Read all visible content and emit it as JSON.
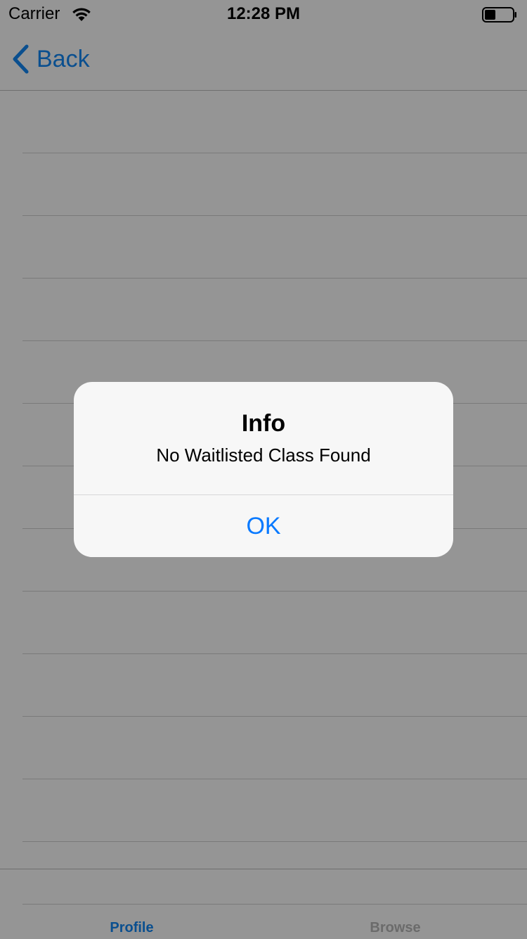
{
  "status_bar": {
    "carrier": "Carrier",
    "time": "12:28 PM",
    "wifi_icon": "wifi-icon",
    "battery_icon": "battery-icon"
  },
  "nav": {
    "back_label": "Back",
    "back_icon": "chevron-left-icon"
  },
  "table": {
    "rows": [
      "",
      "",
      "",
      "",
      "",
      "",
      "",
      "",
      "",
      "",
      "",
      "",
      ""
    ]
  },
  "tab_bar": {
    "tabs": [
      {
        "label": "Profile",
        "selected": true
      },
      {
        "label": "Browse",
        "selected": false
      }
    ]
  },
  "alert": {
    "title": "Info",
    "message": "No Waitlisted Class Found",
    "ok_label": "OK"
  },
  "colors": {
    "accent": "#0a7aff",
    "nav_tint": "#0a4f8f",
    "dim_overlay": "#959595",
    "alert_background": "#f7f7f7"
  }
}
